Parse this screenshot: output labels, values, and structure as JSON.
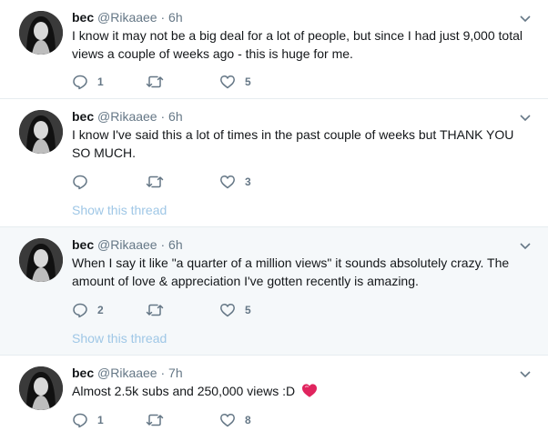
{
  "tweets": [
    {
      "name": "bec",
      "handle": "@Rikaaee",
      "dot": "·",
      "time": "6h",
      "text": "I know it may not be a big deal for a lot of people, but since I had just 9,000 total views a couple of weeks ago - this is huge for me.",
      "reply_count": "1",
      "retweet_count": "",
      "like_count": "5"
    },
    {
      "name": "bec",
      "handle": "@Rikaaee",
      "dot": "·",
      "time": "6h",
      "text": "I know I've said this a lot of times in the past couple of weeks but THANK YOU SO MUCH.",
      "reply_count": "",
      "retweet_count": "",
      "like_count": "3",
      "thread_link": "Show this thread"
    },
    {
      "name": "bec",
      "handle": "@Rikaaee",
      "dot": "·",
      "time": "6h",
      "text": "When I say it like \"a quarter of a million views\" it sounds absolutely crazy. The amount of love & appreciation I've gotten recently is amazing.",
      "reply_count": "2",
      "retweet_count": "",
      "like_count": "5",
      "thread_link": "Show this thread"
    },
    {
      "name": "bec",
      "handle": "@Rikaaee",
      "dot": "·",
      "time": "7h",
      "text": "Almost 2.5k subs and 250,000 views :D",
      "emoji": "heart-emoji",
      "reply_count": "1",
      "retweet_count": "",
      "like_count": "8"
    }
  ],
  "icons": {
    "reply": "reply-icon",
    "retweet": "retweet-icon",
    "like": "heart-icon",
    "menu": "chevron-down-icon"
  },
  "colors": {
    "name": "#14171a",
    "meta": "#657786",
    "thread_link": "#9fc7e6",
    "divider": "#e6ecf0",
    "highlight_bg": "#f5f8fa",
    "heart_emoji": "#e0245e"
  }
}
